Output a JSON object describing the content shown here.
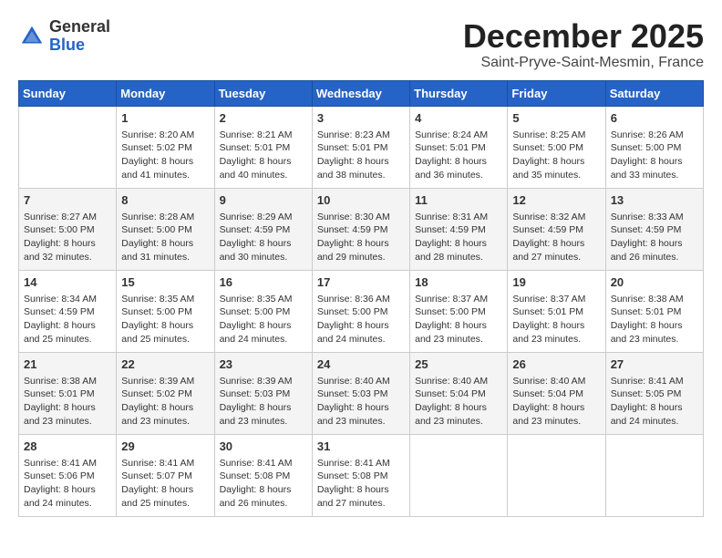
{
  "header": {
    "logo_general": "General",
    "logo_blue": "Blue",
    "month_title": "December 2025",
    "subtitle": "Saint-Pryve-Saint-Mesmin, France"
  },
  "weekdays": [
    "Sunday",
    "Monday",
    "Tuesday",
    "Wednesday",
    "Thursday",
    "Friday",
    "Saturday"
  ],
  "weeks": [
    [
      {
        "day": "",
        "info": ""
      },
      {
        "day": "1",
        "info": "Sunrise: 8:20 AM\nSunset: 5:02 PM\nDaylight: 8 hours\nand 41 minutes."
      },
      {
        "day": "2",
        "info": "Sunrise: 8:21 AM\nSunset: 5:01 PM\nDaylight: 8 hours\nand 40 minutes."
      },
      {
        "day": "3",
        "info": "Sunrise: 8:23 AM\nSunset: 5:01 PM\nDaylight: 8 hours\nand 38 minutes."
      },
      {
        "day": "4",
        "info": "Sunrise: 8:24 AM\nSunset: 5:01 PM\nDaylight: 8 hours\nand 36 minutes."
      },
      {
        "day": "5",
        "info": "Sunrise: 8:25 AM\nSunset: 5:00 PM\nDaylight: 8 hours\nand 35 minutes."
      },
      {
        "day": "6",
        "info": "Sunrise: 8:26 AM\nSunset: 5:00 PM\nDaylight: 8 hours\nand 33 minutes."
      }
    ],
    [
      {
        "day": "7",
        "info": "Sunrise: 8:27 AM\nSunset: 5:00 PM\nDaylight: 8 hours\nand 32 minutes."
      },
      {
        "day": "8",
        "info": "Sunrise: 8:28 AM\nSunset: 5:00 PM\nDaylight: 8 hours\nand 31 minutes."
      },
      {
        "day": "9",
        "info": "Sunrise: 8:29 AM\nSunset: 4:59 PM\nDaylight: 8 hours\nand 30 minutes."
      },
      {
        "day": "10",
        "info": "Sunrise: 8:30 AM\nSunset: 4:59 PM\nDaylight: 8 hours\nand 29 minutes."
      },
      {
        "day": "11",
        "info": "Sunrise: 8:31 AM\nSunset: 4:59 PM\nDaylight: 8 hours\nand 28 minutes."
      },
      {
        "day": "12",
        "info": "Sunrise: 8:32 AM\nSunset: 4:59 PM\nDaylight: 8 hours\nand 27 minutes."
      },
      {
        "day": "13",
        "info": "Sunrise: 8:33 AM\nSunset: 4:59 PM\nDaylight: 8 hours\nand 26 minutes."
      }
    ],
    [
      {
        "day": "14",
        "info": "Sunrise: 8:34 AM\nSunset: 4:59 PM\nDaylight: 8 hours\nand 25 minutes."
      },
      {
        "day": "15",
        "info": "Sunrise: 8:35 AM\nSunset: 5:00 PM\nDaylight: 8 hours\nand 25 minutes."
      },
      {
        "day": "16",
        "info": "Sunrise: 8:35 AM\nSunset: 5:00 PM\nDaylight: 8 hours\nand 24 minutes."
      },
      {
        "day": "17",
        "info": "Sunrise: 8:36 AM\nSunset: 5:00 PM\nDaylight: 8 hours\nand 24 minutes."
      },
      {
        "day": "18",
        "info": "Sunrise: 8:37 AM\nSunset: 5:00 PM\nDaylight: 8 hours\nand 23 minutes."
      },
      {
        "day": "19",
        "info": "Sunrise: 8:37 AM\nSunset: 5:01 PM\nDaylight: 8 hours\nand 23 minutes."
      },
      {
        "day": "20",
        "info": "Sunrise: 8:38 AM\nSunset: 5:01 PM\nDaylight: 8 hours\nand 23 minutes."
      }
    ],
    [
      {
        "day": "21",
        "info": "Sunrise: 8:38 AM\nSunset: 5:01 PM\nDaylight: 8 hours\nand 23 minutes."
      },
      {
        "day": "22",
        "info": "Sunrise: 8:39 AM\nSunset: 5:02 PM\nDaylight: 8 hours\nand 23 minutes."
      },
      {
        "day": "23",
        "info": "Sunrise: 8:39 AM\nSunset: 5:03 PM\nDaylight: 8 hours\nand 23 minutes."
      },
      {
        "day": "24",
        "info": "Sunrise: 8:40 AM\nSunset: 5:03 PM\nDaylight: 8 hours\nand 23 minutes."
      },
      {
        "day": "25",
        "info": "Sunrise: 8:40 AM\nSunset: 5:04 PM\nDaylight: 8 hours\nand 23 minutes."
      },
      {
        "day": "26",
        "info": "Sunrise: 8:40 AM\nSunset: 5:04 PM\nDaylight: 8 hours\nand 23 minutes."
      },
      {
        "day": "27",
        "info": "Sunrise: 8:41 AM\nSunset: 5:05 PM\nDaylight: 8 hours\nand 24 minutes."
      }
    ],
    [
      {
        "day": "28",
        "info": "Sunrise: 8:41 AM\nSunset: 5:06 PM\nDaylight: 8 hours\nand 24 minutes."
      },
      {
        "day": "29",
        "info": "Sunrise: 8:41 AM\nSunset: 5:07 PM\nDaylight: 8 hours\nand 25 minutes."
      },
      {
        "day": "30",
        "info": "Sunrise: 8:41 AM\nSunset: 5:08 PM\nDaylight: 8 hours\nand 26 minutes."
      },
      {
        "day": "31",
        "info": "Sunrise: 8:41 AM\nSunset: 5:08 PM\nDaylight: 8 hours\nand 27 minutes."
      },
      {
        "day": "",
        "info": ""
      },
      {
        "day": "",
        "info": ""
      },
      {
        "day": "",
        "info": ""
      }
    ]
  ]
}
